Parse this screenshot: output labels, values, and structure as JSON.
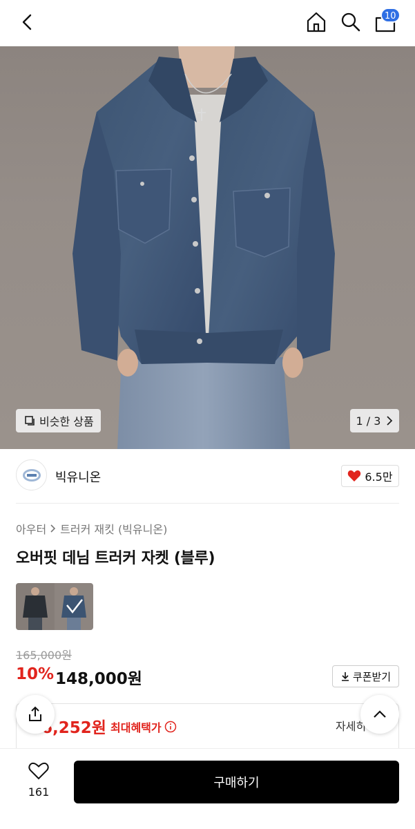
{
  "header": {
    "back_icon": "chevron-left-icon",
    "home_icon": "home-icon",
    "search_icon": "search-icon",
    "cart_icon": "shopping-bag-icon",
    "cart_count": "10"
  },
  "gallery": {
    "similar_label": "비슷한 상품",
    "pager_text": "1 / 3"
  },
  "brand": {
    "name": "빅유니온",
    "likes": "6.5만"
  },
  "product": {
    "breadcrumb": [
      "아우터",
      "트러커 재킷 (빅유니온)"
    ],
    "title": "오버핏 데님 트러커 자켓 (블루)",
    "original_price": "165,000원",
    "discount": "10%",
    "price": "148,000원",
    "coupon_label": "쿠폰받기"
  },
  "benefit": {
    "price": "6,252원",
    "label": "최대혜택가",
    "detail": "자세히"
  },
  "bottom": {
    "wish_count": "161",
    "buy_label": "구매하기"
  },
  "colors": {
    "accent": "#e1241d",
    "badge": "#2f6fe4",
    "buy_button": "#000000"
  }
}
